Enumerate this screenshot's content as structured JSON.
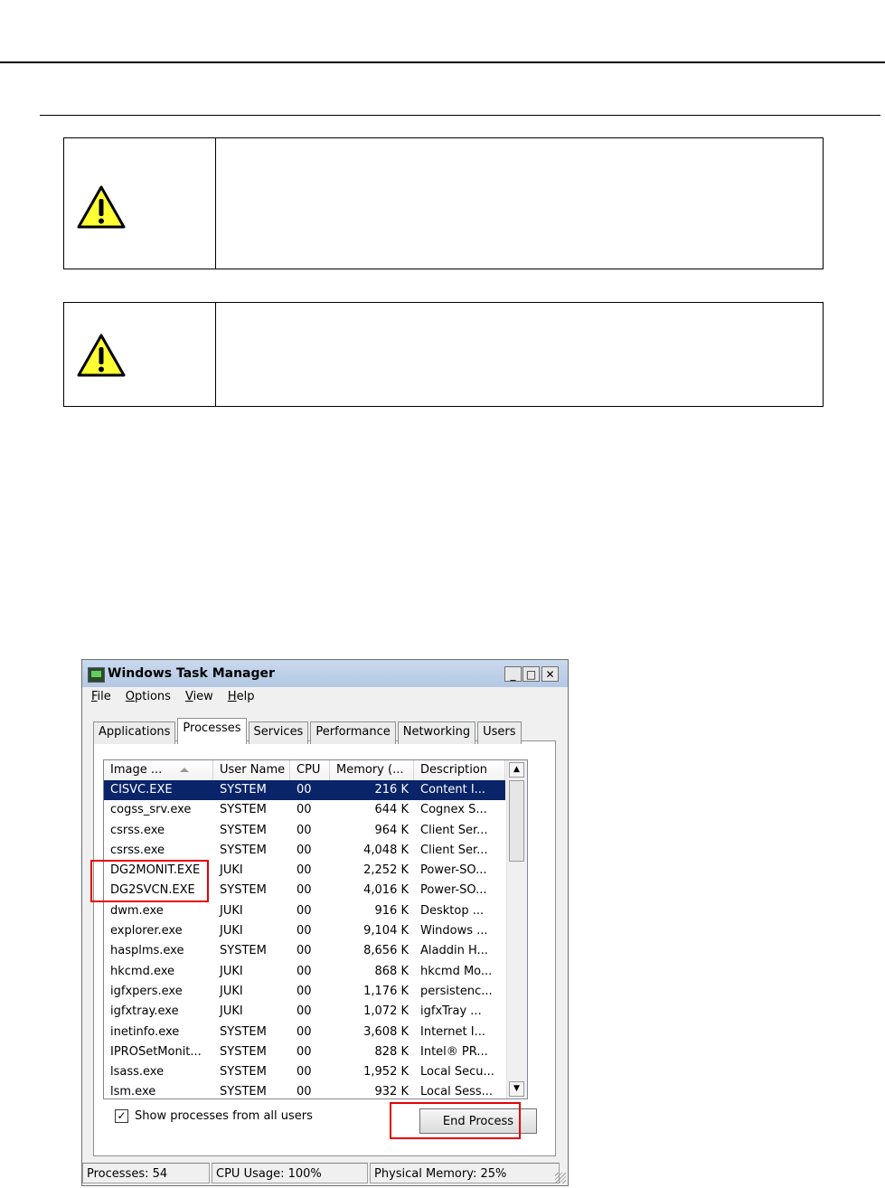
{
  "window": {
    "title": "Windows Task Manager",
    "controls": {
      "minimize": "_",
      "maximize": "□",
      "close": "✕"
    }
  },
  "menu": [
    "File",
    "Options",
    "View",
    "Help"
  ],
  "tabs": [
    "Applications",
    "Processes",
    "Services",
    "Performance",
    "Networking",
    "Users"
  ],
  "active_tab": "Processes",
  "columns": [
    "Image ...",
    "User Name",
    "CPU",
    "Memory (...",
    "Description"
  ],
  "processes": [
    {
      "image": "CISVC.EXE",
      "user": "SYSTEM",
      "cpu": "00",
      "memory": "216 K",
      "description": "Content I..."
    },
    {
      "image": "cogss_srv.exe",
      "user": "SYSTEM",
      "cpu": "00",
      "memory": "644 K",
      "description": "Cognex S..."
    },
    {
      "image": "csrss.exe",
      "user": "SYSTEM",
      "cpu": "00",
      "memory": "964 K",
      "description": "Client Ser..."
    },
    {
      "image": "csrss.exe",
      "user": "SYSTEM",
      "cpu": "00",
      "memory": "4,048 K",
      "description": "Client Ser..."
    },
    {
      "image": "DG2MONIT.EXE",
      "user": "JUKI",
      "cpu": "00",
      "memory": "2,252 K",
      "description": "Power-SO..."
    },
    {
      "image": "DG2SVCN.EXE",
      "user": "SYSTEM",
      "cpu": "00",
      "memory": "4,016 K",
      "description": "Power-SO..."
    },
    {
      "image": "dwm.exe",
      "user": "JUKI",
      "cpu": "00",
      "memory": "916 K",
      "description": "Desktop ..."
    },
    {
      "image": "explorer.exe",
      "user": "JUKI",
      "cpu": "00",
      "memory": "9,104 K",
      "description": "Windows ..."
    },
    {
      "image": "hasplms.exe",
      "user": "SYSTEM",
      "cpu": "00",
      "memory": "8,656 K",
      "description": "Aladdin H..."
    },
    {
      "image": "hkcmd.exe",
      "user": "JUKI",
      "cpu": "00",
      "memory": "868 K",
      "description": "hkcmd Mo..."
    },
    {
      "image": "igfxpers.exe",
      "user": "JUKI",
      "cpu": "00",
      "memory": "1,176 K",
      "description": "persistenc..."
    },
    {
      "image": "igfxtray.exe",
      "user": "JUKI",
      "cpu": "00",
      "memory": "1,072 K",
      "description": "igfxTray ..."
    },
    {
      "image": "inetinfo.exe",
      "user": "SYSTEM",
      "cpu": "00",
      "memory": "3,608 K",
      "description": "Internet I..."
    },
    {
      "image": "IPROSetMonit...",
      "user": "SYSTEM",
      "cpu": "00",
      "memory": "828 K",
      "description": "Intel® PR..."
    },
    {
      "image": "lsass.exe",
      "user": "SYSTEM",
      "cpu": "00",
      "memory": "1,952 K",
      "description": "Local Secu..."
    },
    {
      "image": "lsm.exe",
      "user": "SYSTEM",
      "cpu": "00",
      "memory": "932 K",
      "description": "Local Sess..."
    }
  ],
  "selected_process": "CISVC.EXE",
  "show_all_label": "Show processes from all users",
  "show_all_checked": true,
  "end_process_label": "End Process",
  "status": {
    "processes": "Processes: 54",
    "cpu": "CPU Usage: 100%",
    "memory": "Physical Memory: 25%"
  },
  "colors": {
    "highlight": "#e60000",
    "selection": "#0a246a",
    "warning": "#ffff33"
  }
}
